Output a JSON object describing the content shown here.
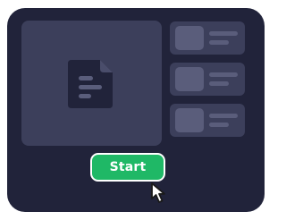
{
  "start_button": {
    "label": "Start"
  },
  "colors": {
    "frame": "#21233a",
    "panel": "#3c3f5b",
    "placeholder": "#5a5d7b",
    "doc_icon": "#21233a",
    "button": "#1fb866"
  },
  "icons": {
    "document": "document-icon",
    "cursor": "mouse-pointer-icon"
  }
}
